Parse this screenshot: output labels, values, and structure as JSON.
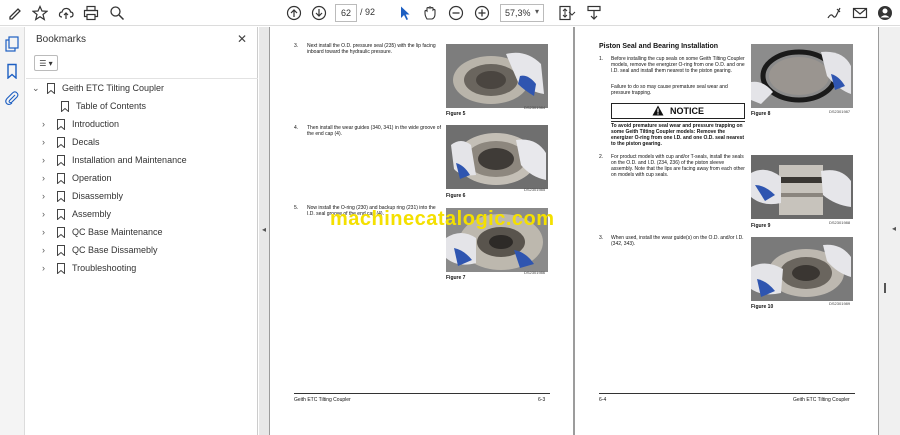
{
  "toolbar": {
    "page_current": "62",
    "page_sep": "/",
    "page_total": "92",
    "zoom": "57,3%"
  },
  "panel": {
    "title": "Bookmarks",
    "close": "✕",
    "options": "☰ ▾"
  },
  "bookmarks": {
    "root": "Geith ETC Tilting Coupler",
    "items": [
      "Table of Contents",
      "Introduction",
      "Decals",
      "Installation and Maintenance",
      "Operation",
      "Disassembly",
      "Assembly",
      "QC Base Maintenance",
      "QC Base Dissamebly",
      "Troubleshooting"
    ]
  },
  "left_page": {
    "step3_num": "3.",
    "step3_text": "Next install the O.D. pressure seal (235) with the lip facing inboard toward the hydraulic pressure.",
    "fig5": "Figure 5",
    "fig5_id": "DS2301984",
    "step4_num": "4.",
    "step4_text": "Then install the wear guides (340, 341) in the wide groove of the end cap (4).",
    "fig6": "Figure 6",
    "fig6_id": "DS2301985",
    "step5_num": "5.",
    "step5_text": "Now install the O-ring (230) and backup ring (231) into the I.D. seal groove of the end cap (4).",
    "fig7": "Figure 7",
    "fig7_id": "DS2301986",
    "footer_left": "Geith ETC Tilting Coupler",
    "footer_right": "6-3"
  },
  "right_page": {
    "section_title": "Piston Seal and Bearing Installation",
    "step1_num": "1.",
    "step1_text": "Before installing the cup seals on some Geith Tilting Coupler models, remove the energizer O-ring from one O.D. and one I.D. seal and install them nearest to the piston gearing.",
    "step1_note": "Failure to do so may cause premature seal wear and pressure trapping.",
    "notice_label": "NOTICE",
    "notice_text": "To avoid premature seal wear and pressure trapping on some Geith Tilting Coupler models: Remove the energizer O-ring from one I.D. and one O.D. seal nearest to the piston gearing.",
    "step2_num": "2.",
    "step2_text": "For product models with cup and/or T-seals, install the seals on the O.D. and I.D. (234, 236) of the piston sleeve assembly. Note that the lips are facing away from each other on models with cup seals.",
    "step3_num": "3.",
    "step3_text": "When used, install the wear guide(s) on the O.D. and/or I.D. (342, 343).",
    "fig8": "Figure 8",
    "fig8_id": "DS2301987",
    "fig9": "Figure 9",
    "fig9_id": "DS2301988",
    "fig10": "Figure 10",
    "fig10_id": "DS2301989",
    "footer_left": "6-4",
    "footer_right": "Geith ETC Tilting Coupler"
  },
  "watermark": "machinecatalogic.com"
}
